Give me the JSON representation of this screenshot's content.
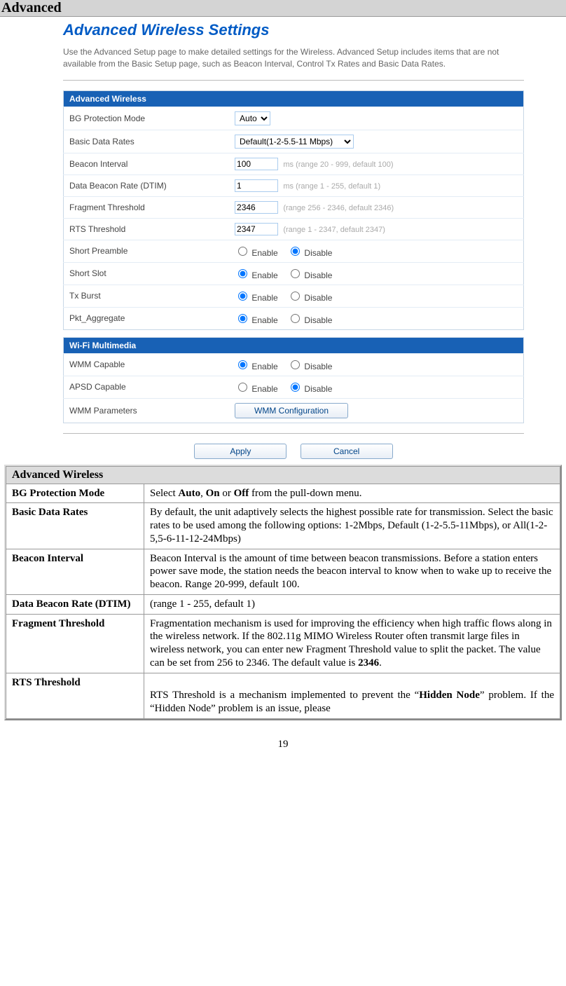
{
  "header": {
    "title": "Advanced"
  },
  "panel": {
    "title": "Advanced Wireless Settings",
    "intro": "Use the Advanced Setup page to make detailed settings for the Wireless. Advanced Setup includes items that are not available from the Basic Setup page, such as Beacon Interval, Control Tx Rates and Basic Data Rates.",
    "aw_section": "Advanced Wireless",
    "wm_section": "Wi-Fi Multimedia",
    "rows": {
      "bg_mode_label": "BG Protection Mode",
      "bg_mode_value": "Auto",
      "basic_rates_label": "Basic Data Rates",
      "basic_rates_value": "Default(1-2-5.5-11 Mbps)",
      "beacon_label": "Beacon Interval",
      "beacon_value": "100",
      "beacon_hint": "ms (range 20 - 999, default 100)",
      "dtim_label": "Data Beacon Rate (DTIM)",
      "dtim_value": "1",
      "dtim_hint": "ms (range 1 - 255, default 1)",
      "frag_label": "Fragment Threshold",
      "frag_value": "2346",
      "frag_hint": "(range 256 - 2346, default 2346)",
      "rts_label": "RTS Threshold",
      "rts_value": "2347",
      "rts_hint": "(range 1 - 2347, default 2347)",
      "short_preamble_label": "Short Preamble",
      "short_slot_label": "Short Slot",
      "txburst_label": "Tx Burst",
      "pkt_agg_label": "Pkt_Aggregate",
      "wmm_capable_label": "WMM Capable",
      "apsd_label": "APSD Capable",
      "wmm_params_label": "WMM Parameters",
      "enable": "Enable",
      "disable": "Disable",
      "wmm_btn": "WMM Configuration"
    },
    "buttons": {
      "apply": "Apply",
      "cancel": "Cancel"
    }
  },
  "desc": {
    "section": "Advanced Wireless",
    "items": [
      {
        "term": "BG Protection Mode",
        "body_pre": "Select ",
        "b1": "Auto",
        "mid1": ", ",
        "b2": "On",
        "mid2": " or ",
        "b3": "Off",
        "body_post": " from the pull-down menu."
      },
      {
        "term": "Basic Data Rates",
        "text": "By default, the unit adaptively selects the highest possible rate for transmission. Select the basic rates to be used among the following options: 1-2Mbps, Default (1-2-5.5-11Mbps), or All(1-2-5,5-6-11-12-24Mbps)"
      },
      {
        "term": "Beacon Interval",
        "text": "Beacon Interval is the amount of time between beacon transmissions. Before a station enters power save mode, the station needs the beacon interval to know when to wake up to receive the beacon. Range 20-999, default 100."
      },
      {
        "term": "Data Beacon Rate (DTIM)",
        "text": "(range 1 - 255, default 1)"
      },
      {
        "term": "Fragment Threshold",
        "text_pre": "Fragmentation mechanism is used for improving the efficiency when high traffic flows along in the wireless network. If the 802.11g MIMO Wireless Router often transmit large files in wireless network, you can enter new Fragment Threshold value to split the packet.  The value can be set from 256 to 2346. The default value is ",
        "bold": "2346",
        "text_post": "."
      },
      {
        "term": "RTS Threshold",
        "text_pre": "RTS Threshold is a mechanism implemented to prevent the “",
        "b1": "Hidden Node",
        "mid": "” problem. If the “Hidden Node” problem is an issue, please"
      }
    ]
  },
  "page_number": "19"
}
